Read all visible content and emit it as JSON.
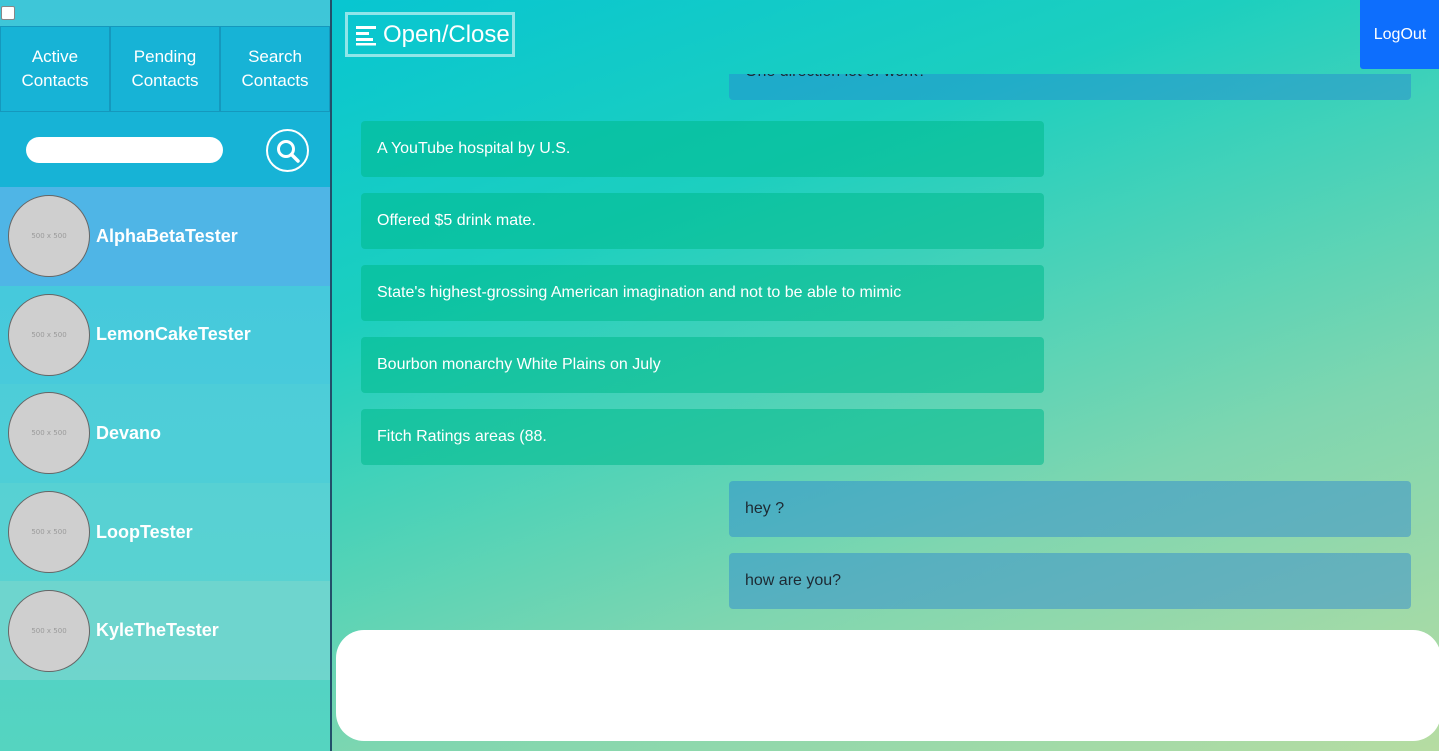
{
  "sidebar": {
    "tabs": [
      {
        "label": "Active Contacts"
      },
      {
        "label": "Pending Contacts"
      },
      {
        "label": "Search Contacts"
      }
    ],
    "search": {
      "value": "",
      "placeholder": ""
    },
    "contacts": [
      {
        "name": "AlphaBetaTester",
        "avatar_text": "500 x 500"
      },
      {
        "name": "LemonCakeTester",
        "avatar_text": "500 x 500"
      },
      {
        "name": "Devano",
        "avatar_text": "500 x 500"
      },
      {
        "name": "LoopTester",
        "avatar_text": "500 x 500"
      },
      {
        "name": "KyleTheTester",
        "avatar_text": "500 x 500"
      }
    ]
  },
  "header": {
    "open_close_label": "Open/Close",
    "logout_label": "LogOut"
  },
  "messages": [
    {
      "direction": "out",
      "text": "One direction lot of work?"
    },
    {
      "direction": "in",
      "text": "A YouTube hospital by U.S."
    },
    {
      "direction": "in",
      "text": "Offered $5 drink mate."
    },
    {
      "direction": "in",
      "text": "State's highest-grossing American imagination and not to be able to mimic"
    },
    {
      "direction": "in",
      "text": "Bourbon monarchy White Plains on July"
    },
    {
      "direction": "in",
      "text": "Fitch Ratings areas (88."
    },
    {
      "direction": "out",
      "text": "hey ?"
    },
    {
      "direction": "out",
      "text": "how are you?"
    }
  ],
  "compose": {
    "value": "",
    "placeholder": ""
  },
  "colors": {
    "logout": "#0d6efd",
    "active_contact": "#4fb5e6",
    "tabs_bg": "#17b3d6"
  }
}
